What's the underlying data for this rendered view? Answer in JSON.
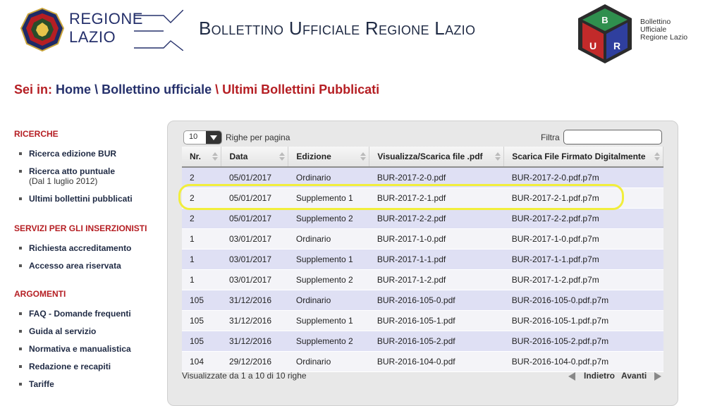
{
  "header": {
    "regione_line1": "REGIONE",
    "regione_line2": "LAZIO",
    "title": "Bollettino Ufficiale Regione Lazio",
    "bur_letters": [
      "B",
      "U",
      "R"
    ],
    "bur_sub": [
      "Bollettino",
      "Ufficiale",
      "Regione Lazio"
    ]
  },
  "breadcrumb": {
    "prefix": "Sei in:",
    "home": "Home",
    "sep": "\\",
    "section": "Bollettino ufficiale",
    "current": "Ultimi Bollettini Pubblicati"
  },
  "sidebar": {
    "sections": [
      {
        "heading": "RICERCHE",
        "items": [
          {
            "label": "Ricerca edizione BUR"
          },
          {
            "label": "Ricerca atto puntuale",
            "sub": "(Dal 1 luglio 2012)"
          },
          {
            "label": "Ultimi bollettini pubblicati"
          }
        ]
      },
      {
        "heading": "SERVIZI PER GLI INSERZIONISTI",
        "items": [
          {
            "label": "Richiesta accreditamento"
          },
          {
            "label": "Accesso area riservata"
          }
        ]
      },
      {
        "heading": "ARGOMENTI",
        "items": [
          {
            "label": "FAQ - Domande frequenti"
          },
          {
            "label": "Guida al servizio"
          },
          {
            "label": "Normativa e manualistica"
          },
          {
            "label": "Redazione e recapiti"
          },
          {
            "label": "Tariffe"
          }
        ]
      }
    ]
  },
  "table_controls": {
    "page_size": "10",
    "rows_label": "Righe per pagina",
    "filter_label": "Filtra",
    "filter_value": ""
  },
  "table": {
    "columns": [
      "Nr.",
      "Data",
      "Edizione",
      "Visualizza/Scarica file .pdf",
      "Scarica File Firmato Digitalmente"
    ],
    "rows": [
      [
        "2",
        "05/01/2017",
        "Ordinario",
        "BUR-2017-2-0.pdf",
        "BUR-2017-2-0.pdf.p7m"
      ],
      [
        "2",
        "05/01/2017",
        "Supplemento 1",
        "BUR-2017-2-1.pdf",
        "BUR-2017-2-1.pdf.p7m"
      ],
      [
        "2",
        "05/01/2017",
        "Supplemento 2",
        "BUR-2017-2-2.pdf",
        "BUR-2017-2-2.pdf.p7m"
      ],
      [
        "1",
        "03/01/2017",
        "Ordinario",
        "BUR-2017-1-0.pdf",
        "BUR-2017-1-0.pdf.p7m"
      ],
      [
        "1",
        "03/01/2017",
        "Supplemento 1",
        "BUR-2017-1-1.pdf",
        "BUR-2017-1-1.pdf.p7m"
      ],
      [
        "1",
        "03/01/2017",
        "Supplemento 2",
        "BUR-2017-1-2.pdf",
        "BUR-2017-1-2.pdf.p7m"
      ],
      [
        "105",
        "31/12/2016",
        "Ordinario",
        "BUR-2016-105-0.pdf",
        "BUR-2016-105-0.pdf.p7m"
      ],
      [
        "105",
        "31/12/2016",
        "Supplemento 1",
        "BUR-2016-105-1.pdf",
        "BUR-2016-105-1.pdf.p7m"
      ],
      [
        "105",
        "31/12/2016",
        "Supplemento 2",
        "BUR-2016-105-2.pdf",
        "BUR-2016-105-2.pdf.p7m"
      ],
      [
        "104",
        "29/12/2016",
        "Ordinario",
        "BUR-2016-104-0.pdf",
        "BUR-2016-104-0.pdf.p7m"
      ]
    ]
  },
  "pager": {
    "info": "Visualizzate da 1 a 10 di 10 righe",
    "prev": "Indietro",
    "next": "Avanti"
  },
  "colors": {
    "brand_red": "#b51e23",
    "brand_blue": "#25306b",
    "highlight": "#f1ee3c",
    "row_odd": "#dfe0f4"
  }
}
